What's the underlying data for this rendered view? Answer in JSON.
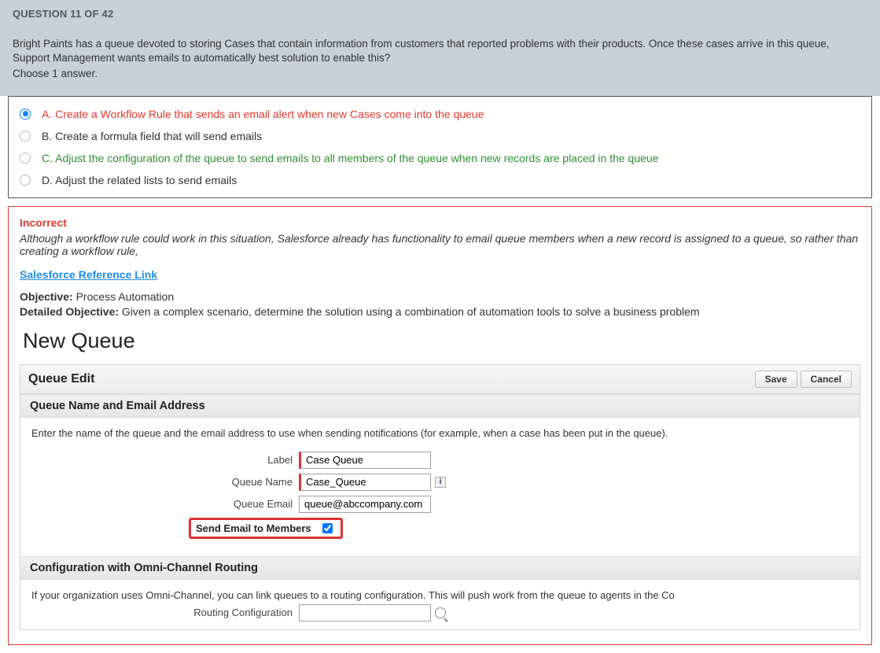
{
  "header": {
    "counter": "QUESTION 11 OF 42"
  },
  "question": {
    "text": "Bright Paints has a queue devoted to storing Cases that contain information from customers that reported problems with their products. Once these cases arrive in this queue, Support Management wants emails to automatically best solution to enable this?",
    "choose": "Choose 1 answer."
  },
  "answers": [
    {
      "label": "A. Create a Workflow Rule that sends an email alert when new Cases come into the queue",
      "cls": "ans-red",
      "selected": true
    },
    {
      "label": "B. Create a formula field that will send emails",
      "cls": "ans-norm",
      "selected": false
    },
    {
      "label": "C. Adjust the configuration of the queue to send emails to all members of the queue when new records are placed in the queue",
      "cls": "ans-green",
      "selected": false
    },
    {
      "label": "D. Adjust the related lists to send emails",
      "cls": "ans-norm",
      "selected": false
    }
  ],
  "feedback": {
    "title": "Incorrect",
    "explain": "Although a workflow rule could work in this situation, Salesforce already has functionality to email queue members when a new record is assigned to a queue, so rather than creating a workflow rule,",
    "link": "Salesforce Reference Link",
    "objective_label": "Objective:",
    "objective_value": " Process Automation",
    "detailed_label": "Detailed Objective:",
    "detailed_value": " Given a complex scenario, determine the solution using a combination of automation tools to solve a business problem"
  },
  "sf": {
    "heading": "New Queue",
    "edit_title": "Queue Edit",
    "save": "Save",
    "cancel": "Cancel",
    "sec1": "Queue Name and Email Address",
    "desc1": "Enter the name of the queue and the email address to use when sending notifications (for example, when a case has been put in the queue).",
    "labels": {
      "label": "Label",
      "queue_name": "Queue Name",
      "queue_email": "Queue Email",
      "send_members": "Send Email to Members",
      "routing": "Routing Configuration"
    },
    "values": {
      "label": "Case Queue",
      "queue_name": "Case_Queue",
      "queue_email": "queue@abccompany.com"
    },
    "sec2": "Configuration with Omni-Channel Routing",
    "desc2": "If your organization uses Omni-Channel, you can link queues to a routing configuration. This will push work from the queue to agents in the Co"
  }
}
